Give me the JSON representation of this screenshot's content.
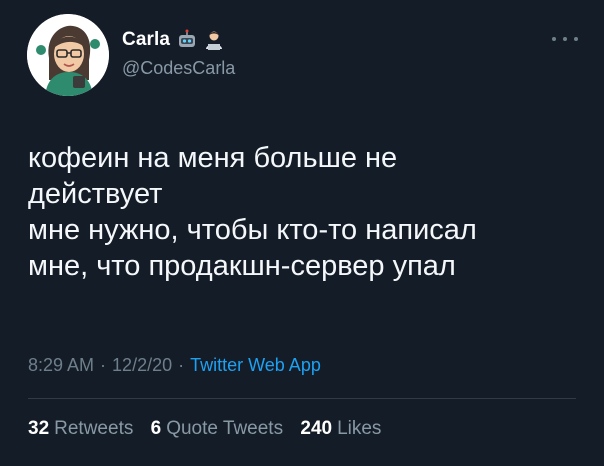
{
  "author": {
    "display_name": "Carla",
    "handle": "@CodesCarla",
    "avatar_icon": "avatar-illustration-woman-with-glasses",
    "name_emojis": [
      "robot-emoji",
      "technologist-emoji"
    ]
  },
  "tweet": {
    "lines": [
      "кофеин на меня больше не",
      "действует",
      "мне нужно, чтобы кто-то написал",
      "мне, что продакшн-сервер упал"
    ]
  },
  "meta": {
    "time": "8:29 AM",
    "date": "12/2/20",
    "source": "Twitter Web App",
    "separator": "·"
  },
  "stats": {
    "retweets_count": "32",
    "retweets_label": "Retweets",
    "quotes_count": "6",
    "quotes_label": "Quote Tweets",
    "likes_count": "240",
    "likes_label": "Likes"
  },
  "colors": {
    "background": "#141c27",
    "text": "#f5f8fa",
    "muted": "#8899a6",
    "link": "#1da1f2"
  },
  "icons": {
    "more": "more-options-icon"
  }
}
